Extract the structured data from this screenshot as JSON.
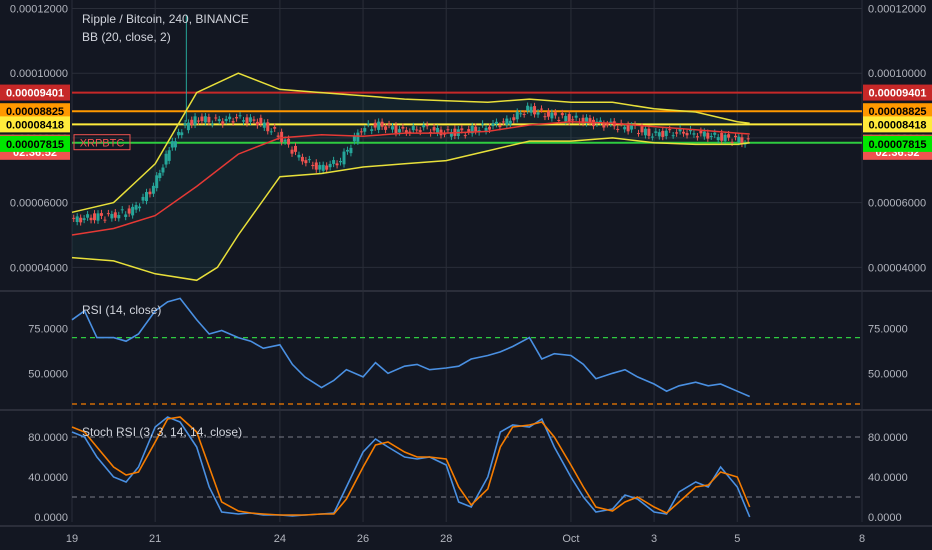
{
  "header": {
    "title": "Ripple / Bitcoin, 240, BINANCE",
    "bb_label": "BB (20, close, 2)",
    "symbol_tag": "XRPBTC",
    "countdown": "02:36:52"
  },
  "rsi_panel": {
    "label": "RSI (14, close)"
  },
  "stoch_panel": {
    "label": "Stoch RSI (3, 3, 14, 14, close)"
  },
  "colors": {
    "background": "#131722",
    "grid": "#2a2e39",
    "candle_up": "#26a69a",
    "candle_down": "#ef5350",
    "bb_band": "#e8e03a",
    "bb_basis": "#e53935",
    "rsi_line": "#4a90e2",
    "stoch_k": "#4a90e2",
    "stoch_d": "#f57c00",
    "line_red": "#c62828",
    "line_orange": "#ff9800",
    "line_yellow": "#ffeb3b",
    "line_green": "#2ecc40",
    "rsi_upper_dash": "#2ecc40",
    "rsi_lower_dash": "#f57c00"
  },
  "chart_data": [
    {
      "type": "candlestick",
      "title": "Ripple / Bitcoin, 240, BINANCE",
      "y_axis_ticks": [
        "0.00012000",
        "0.00010000",
        "0.00008000",
        "0.00006000",
        "0.00004000"
      ],
      "x_axis_ticks": [
        "19",
        "21",
        "24",
        "26",
        "28",
        "Oct",
        "3",
        "5",
        "8"
      ],
      "ylim": [
        3.3e-05,
        0.000122
      ],
      "x_day_range": [
        19,
        38
      ],
      "price_lines": [
        {
          "label": "0.00009401",
          "value": 9.401e-05,
          "color": "#c62828",
          "text_color": "#ffffff"
        },
        {
          "label": "0.00008825",
          "value": 8.825e-05,
          "color": "#ff9800",
          "text_color": "#000000"
        },
        {
          "label": "0.00008418",
          "value": 8.418e-05,
          "color": "#ffeb3b",
          "text_color": "#000000"
        },
        {
          "label": "0.00007852",
          "value": 7.852e-05,
          "color": "#2ecc40",
          "text_color": "#ffffff"
        }
      ],
      "current_price_label": {
        "label": "0.00007852",
        "value": 7.852e-05,
        "color": "#ef5350"
      },
      "countdown_label": {
        "label": "02:36:52",
        "value": 7.57e-05,
        "color": "#ef5350"
      },
      "extra_label": {
        "label": "0.00007815",
        "value": 7.815e-05,
        "color": "#00e600",
        "text_color": "#000000"
      },
      "candles_daily_close": [
        [
          19.0,
          5.45e-05
        ],
        [
          19.5,
          5.55e-05
        ],
        [
          20.0,
          5.6e-05
        ],
        [
          20.5,
          5.75e-05
        ],
        [
          21.0,
          6.5e-05
        ],
        [
          21.3,
          7.4e-05
        ],
        [
          21.6,
          8.2e-05
        ],
        [
          22.0,
          8.6e-05
        ],
        [
          22.5,
          8.5e-05
        ],
        [
          23.0,
          8.6e-05
        ],
        [
          23.5,
          8.5e-05
        ],
        [
          24.0,
          8.1e-05
        ],
        [
          24.5,
          7.4e-05
        ],
        [
          25.0,
          7.05e-05
        ],
        [
          25.5,
          7.3e-05
        ],
        [
          26.0,
          8.3e-05
        ],
        [
          26.5,
          8.4e-05
        ],
        [
          27.0,
          8.2e-05
        ],
        [
          27.5,
          8.3e-05
        ],
        [
          28.0,
          8.15e-05
        ],
        [
          28.5,
          8.2e-05
        ],
        [
          29.0,
          8.35e-05
        ],
        [
          29.5,
          8.5e-05
        ],
        [
          30.0,
          8.9e-05
        ],
        [
          30.5,
          8.7e-05
        ],
        [
          31.0,
          8.6e-05
        ],
        [
          31.5,
          8.5e-05
        ],
        [
          32.0,
          8.4e-05
        ],
        [
          32.5,
          8.3e-05
        ],
        [
          33.0,
          8.1e-05
        ],
        [
          33.5,
          8.2e-05
        ],
        [
          34.0,
          8.15e-05
        ],
        [
          34.5,
          8.05e-05
        ],
        [
          35.0,
          7.95e-05
        ],
        [
          35.3,
          7.85e-05
        ]
      ],
      "bb_upper": [
        [
          19.0,
          5.7e-05
        ],
        [
          20.0,
          6e-05
        ],
        [
          21.0,
          7.2e-05
        ],
        [
          22.0,
          9.4e-05
        ],
        [
          23.0,
          0.0001
        ],
        [
          24.0,
          9.5e-05
        ],
        [
          25.0,
          9.4e-05
        ],
        [
          26.0,
          9.3e-05
        ],
        [
          27.0,
          9.2e-05
        ],
        [
          28.0,
          9.15e-05
        ],
        [
          29.0,
          9.1e-05
        ],
        [
          30.0,
          9.2e-05
        ],
        [
          31.0,
          9.1e-05
        ],
        [
          32.0,
          9.1e-05
        ],
        [
          33.0,
          8.9e-05
        ],
        [
          34.0,
          8.8e-05
        ],
        [
          35.0,
          8.5e-05
        ],
        [
          35.3,
          8.45e-05
        ]
      ],
      "bb_basis": [
        [
          19.0,
          5e-05
        ],
        [
          20.0,
          5.2e-05
        ],
        [
          21.0,
          5.6e-05
        ],
        [
          22.0,
          6.5e-05
        ],
        [
          23.0,
          7.5e-05
        ],
        [
          24.0,
          8e-05
        ],
        [
          25.0,
          8.1e-05
        ],
        [
          26.0,
          8.05e-05
        ],
        [
          27.0,
          8.15e-05
        ],
        [
          28.0,
          8.15e-05
        ],
        [
          29.0,
          8.2e-05
        ],
        [
          30.0,
          8.4e-05
        ],
        [
          31.0,
          8.5e-05
        ],
        [
          32.0,
          8.45e-05
        ],
        [
          33.0,
          8.35e-05
        ],
        [
          34.0,
          8.25e-05
        ],
        [
          35.0,
          8.15e-05
        ],
        [
          35.3,
          8.12e-05
        ]
      ],
      "bb_lower": [
        [
          19.0,
          4.3e-05
        ],
        [
          20.0,
          4.2e-05
        ],
        [
          21.0,
          3.8e-05
        ],
        [
          22.0,
          3.6e-05
        ],
        [
          22.5,
          4e-05
        ],
        [
          23.0,
          5e-05
        ],
        [
          24.0,
          6.8e-05
        ],
        [
          25.0,
          6.9e-05
        ],
        [
          26.0,
          7.1e-05
        ],
        [
          27.0,
          7.2e-05
        ],
        [
          28.0,
          7.3e-05
        ],
        [
          29.0,
          7.6e-05
        ],
        [
          30.0,
          7.9e-05
        ],
        [
          31.0,
          7.9e-05
        ],
        [
          32.0,
          8e-05
        ],
        [
          33.0,
          7.85e-05
        ],
        [
          34.0,
          7.8e-05
        ],
        [
          35.0,
          7.8e-05
        ],
        [
          35.3,
          7.85e-05
        ]
      ]
    },
    {
      "type": "line",
      "title": "RSI (14, close)",
      "y_axis_ticks": [
        "75.0000",
        "50.0000"
      ],
      "ylim": [
        30,
        95
      ],
      "upper_band": 70,
      "lower_band": 30,
      "series": [
        {
          "name": "RSI",
          "x": [
            19.0,
            19.3,
            19.6,
            20.0,
            20.3,
            20.6,
            21.0,
            21.3,
            21.6,
            22.0,
            22.3,
            22.6,
            23.0,
            23.3,
            23.6,
            24.0,
            24.3,
            24.6,
            25.0,
            25.3,
            25.6,
            26.0,
            26.3,
            26.6,
            27.0,
            27.3,
            27.6,
            28.0,
            28.3,
            28.6,
            29.0,
            29.3,
            29.6,
            30.0,
            30.3,
            30.6,
            31.0,
            31.3,
            31.6,
            32.0,
            32.3,
            32.6,
            33.0,
            33.3,
            33.6,
            34.0,
            34.3,
            34.6,
            35.0,
            35.3
          ],
          "y": [
            80,
            85,
            70,
            70,
            68,
            72,
            85,
            90,
            92,
            80,
            72,
            74,
            70,
            68,
            64,
            66,
            55,
            48,
            42,
            46,
            52,
            48,
            56,
            50,
            54,
            55,
            52,
            53,
            54,
            58,
            60,
            62,
            65,
            70,
            58,
            61,
            60,
            55,
            47,
            50,
            52,
            48,
            44,
            40,
            43,
            45,
            43,
            44,
            40,
            37
          ]
        }
      ]
    },
    {
      "type": "line",
      "title": "Stoch RSI (3, 3, 14, 14, close)",
      "y_axis_ticks": [
        "80.0000",
        "40.0000",
        "0.0000"
      ],
      "ylim": [
        -5,
        105
      ],
      "upper_band": 80,
      "lower_band": 20,
      "series": [
        {
          "name": "K",
          "x": [
            19.0,
            19.3,
            19.6,
            20.0,
            20.3,
            20.6,
            21.0,
            21.3,
            21.6,
            22.0,
            22.3,
            22.6,
            23.0,
            23.3,
            23.6,
            24.0,
            24.3,
            24.6,
            25.0,
            25.3,
            25.6,
            26.0,
            26.3,
            26.6,
            27.0,
            27.3,
            27.6,
            28.0,
            28.3,
            28.6,
            29.0,
            29.3,
            29.6,
            30.0,
            30.3,
            30.6,
            31.0,
            31.3,
            31.6,
            32.0,
            32.3,
            32.6,
            33.0,
            33.3,
            33.6,
            34.0,
            34.3,
            34.6,
            35.0,
            35.3
          ],
          "y": [
            85,
            80,
            60,
            40,
            35,
            50,
            90,
            100,
            95,
            70,
            30,
            5,
            3,
            4,
            2,
            2,
            1,
            2,
            3,
            4,
            30,
            65,
            78,
            70,
            60,
            58,
            60,
            52,
            15,
            10,
            40,
            85,
            92,
            90,
            98,
            70,
            40,
            20,
            5,
            8,
            22,
            18,
            5,
            3,
            25,
            35,
            30,
            50,
            30,
            0
          ]
        },
        {
          "name": "D",
          "x": [
            19.0,
            19.3,
            19.6,
            20.0,
            20.3,
            20.6,
            21.0,
            21.3,
            21.6,
            22.0,
            22.3,
            22.6,
            23.0,
            23.3,
            23.6,
            24.0,
            24.3,
            24.6,
            25.0,
            25.3,
            25.6,
            26.0,
            26.3,
            26.6,
            27.0,
            27.3,
            27.6,
            28.0,
            28.3,
            28.6,
            29.0,
            29.3,
            29.6,
            30.0,
            30.3,
            30.6,
            31.0,
            31.3,
            31.6,
            32.0,
            32.3,
            32.6,
            33.0,
            33.3,
            33.6,
            34.0,
            34.3,
            34.6,
            35.0,
            35.3
          ],
          "y": [
            90,
            85,
            70,
            50,
            42,
            45,
            75,
            98,
            100,
            85,
            50,
            15,
            6,
            4,
            3,
            2,
            2,
            2,
            3,
            3,
            18,
            50,
            72,
            75,
            65,
            60,
            60,
            58,
            30,
            12,
            28,
            70,
            90,
            92,
            95,
            80,
            52,
            30,
            10,
            6,
            15,
            20,
            10,
            4,
            15,
            30,
            32,
            45,
            40,
            10
          ]
        }
      ]
    }
  ]
}
